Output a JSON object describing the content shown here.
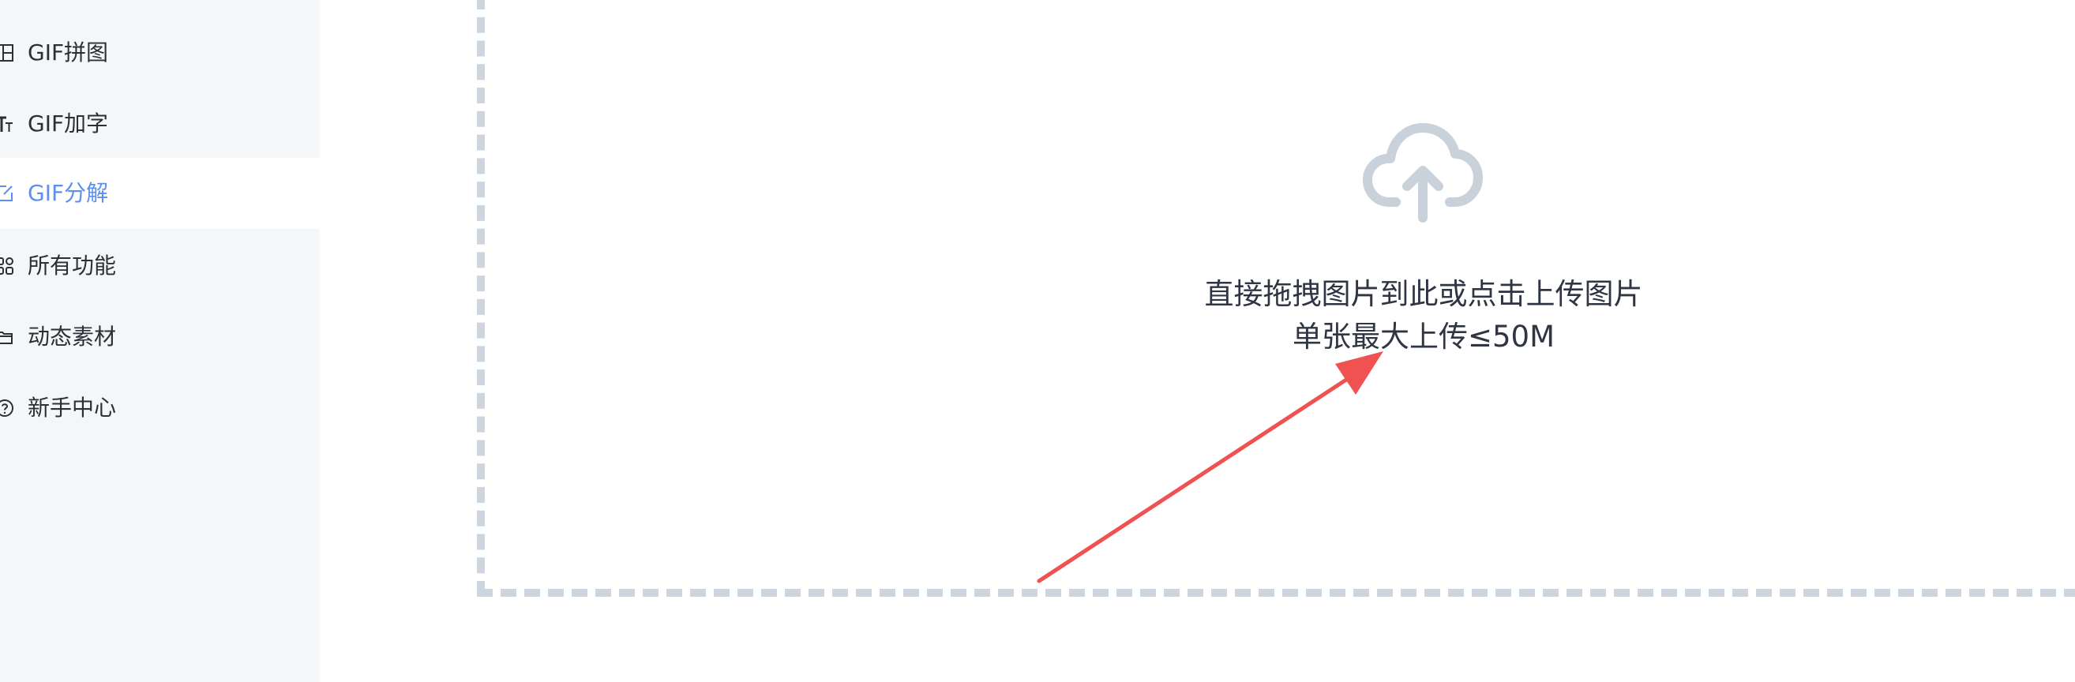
{
  "sidebar": {
    "items": [
      {
        "label": "GIF拼图",
        "icon": "grid-puzzle-icon",
        "active": false
      },
      {
        "label": "GIF加字",
        "icon": "text-icon",
        "active": false
      },
      {
        "label": "GIF分解",
        "icon": "edit-icon",
        "active": true
      },
      {
        "label": "所有功能",
        "icon": "apps-icon",
        "active": false
      },
      {
        "label": "动态素材",
        "icon": "folder-icon",
        "active": false
      },
      {
        "label": "新手中心",
        "icon": "help-icon",
        "active": false
      }
    ]
  },
  "upload": {
    "line1": "直接拖拽图片到此或点击上传图片",
    "line2": "单张最大上传≤50M",
    "icon": "cloud-upload-icon"
  },
  "colors": {
    "sidebar_bg": "#f5f6f8",
    "active_text": "#5b8ff0",
    "dash_border": "#cdd5de",
    "cloud_icon": "#c9d1da",
    "annotation_arrow": "#f05252"
  }
}
